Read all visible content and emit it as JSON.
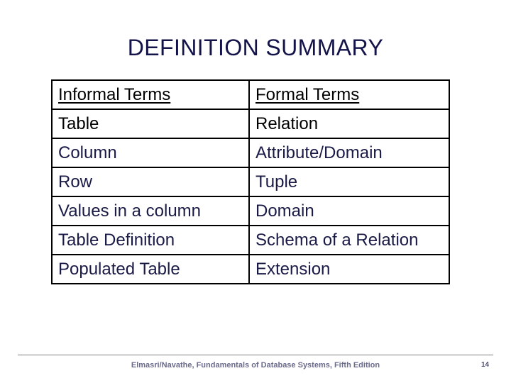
{
  "slide": {
    "title": "DEFINITION SUMMARY"
  },
  "table": {
    "columns": [
      "Informal Terms",
      "Formal Terms"
    ],
    "rows": [
      {
        "informal": "Table",
        "formal": "Relation"
      },
      {
        "informal": "Column",
        "formal": "Attribute/Domain"
      },
      {
        "informal": "Row",
        "formal": "Tuple"
      },
      {
        "informal": "Values in a column",
        "formal": "Domain"
      },
      {
        "informal": "Table Definition",
        "formal": "Schema of a Relation"
      },
      {
        "informal": "Populated Table",
        "formal": "Extension"
      }
    ]
  },
  "footer": {
    "credit": "Elmasri/Navathe, Fundamentals of Database Systems, Fifth Edition",
    "page_number": "14"
  },
  "colors": {
    "title": "#13134a",
    "body_text": "#1a1a47",
    "header_text": "#000000",
    "border": "#000000",
    "footer_text": "#6b6b8c",
    "footer_rule": "#808080",
    "background": "#ffffff"
  }
}
